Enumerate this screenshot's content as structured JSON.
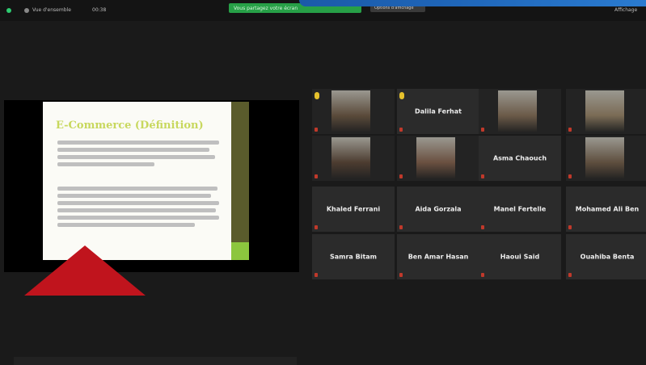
{
  "topbar": {
    "status_text": "Vue d'ensemble",
    "timer": "00:38",
    "share_notice": "Vous partagez votre écran",
    "view_options": "Options d'affichage",
    "right_control": "Affichage"
  },
  "slide": {
    "title": "E-Commerce (Définition)"
  },
  "participants": [
    {
      "name": "",
      "has_video": true
    },
    {
      "name": "Dalila Ferhat",
      "has_video": false
    },
    {
      "name": "",
      "has_video": true
    },
    {
      "name": "",
      "has_video": true
    },
    {
      "name": "",
      "has_video": true
    },
    {
      "name": "",
      "has_video": true
    },
    {
      "name": "Asma Chaouch",
      "has_video": false
    },
    {
      "name": "",
      "has_video": true
    },
    {
      "name": "Khaled Ferrani",
      "has_video": false
    },
    {
      "name": "Aida Gorzala",
      "has_video": false
    },
    {
      "name": "Manel Fertelle",
      "has_video": false
    },
    {
      "name": "Mohamed Ali Ben",
      "has_video": false
    },
    {
      "name": "Samra Bitam",
      "has_video": false
    },
    {
      "name": "Ben Amar Hasan",
      "has_video": false
    },
    {
      "name": "Haoui Said",
      "has_video": false
    },
    {
      "name": "Ouahiba Benta",
      "has_video": false
    }
  ],
  "colors": {
    "share_green": "#27a047",
    "accent_blue": "#1e64b7",
    "corner_red": "#c0141d",
    "slide_title": "#c8d85e"
  }
}
